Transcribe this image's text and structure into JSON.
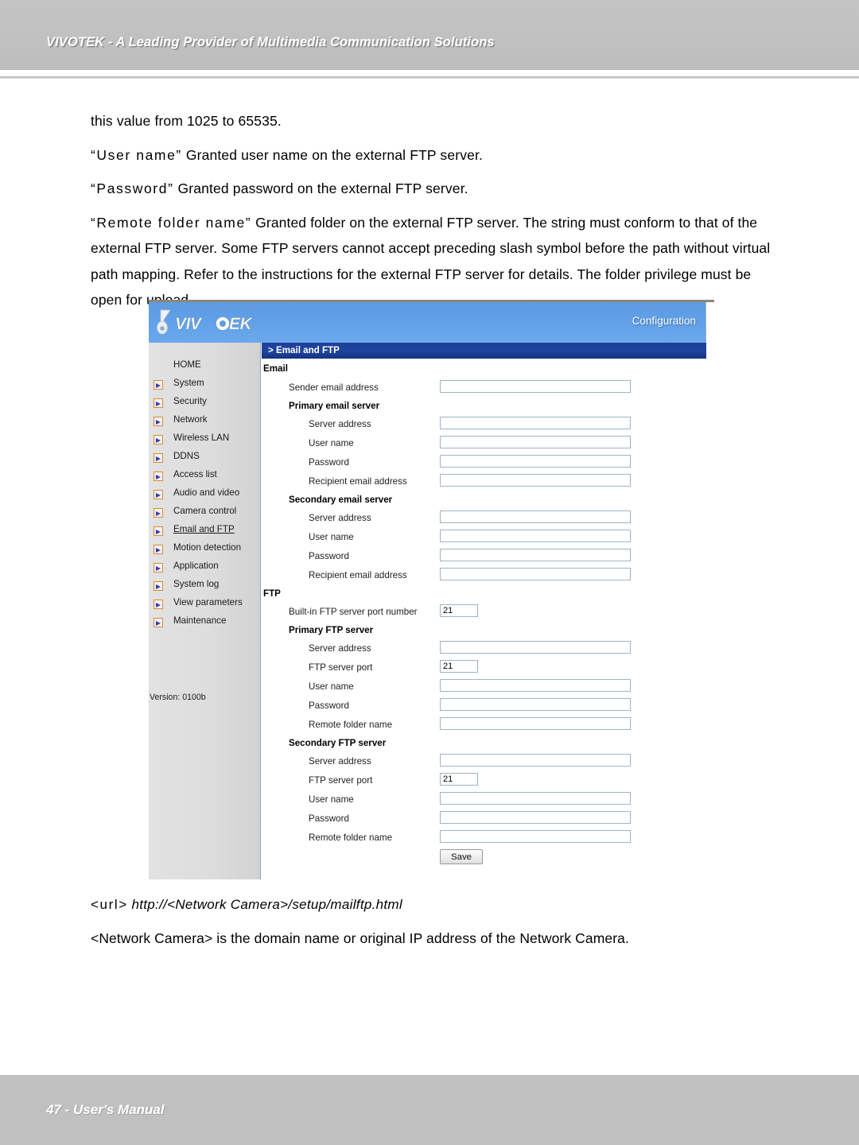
{
  "page": {
    "header_title": "VIVOTEK - A Leading Provider of Multimedia Communication Solutions",
    "footer_text": "47 - User's Manual"
  },
  "prose": {
    "line1": "this value from 1025 to 65535.",
    "line2_term": "“User name”",
    "line2_rest": " Granted user name on the external FTP server.",
    "line3_term": "“Password”",
    "line3_rest": " Granted password on the external FTP server.",
    "line4_term": "“Remote folder name”",
    "line4_rest": " Granted folder on the external FTP server. The string must conform to that of the external FTP server. Some FTP servers cannot accept preceding slash symbol before the path without virtual path mapping. Refer to the instructions for the external FTP server for details. The folder privilege must be open for upload.",
    "url_tag": "<url>",
    "url_value": "http://<Network Camera>/setup/mailftp.html",
    "url_note": "<Network Camera> is the domain name or original IP address of the Network Camera."
  },
  "screenshot": {
    "brand": "VIVOTEK",
    "config_label": "Configuration",
    "breadcrumb": "> Email and FTP",
    "version": "Version: 0100b",
    "sidebar": {
      "home": "HOME",
      "items": [
        {
          "label": "System",
          "active": false
        },
        {
          "label": "Security",
          "active": false
        },
        {
          "label": "Network",
          "active": false
        },
        {
          "label": "Wireless LAN",
          "active": false
        },
        {
          "label": "DDNS",
          "active": false
        },
        {
          "label": "Access list",
          "active": false
        },
        {
          "label": "Audio and video",
          "active": false
        },
        {
          "label": "Camera control",
          "active": false
        },
        {
          "label": "Email and FTP",
          "active": true
        },
        {
          "label": "Motion detection",
          "active": false
        },
        {
          "label": "Application",
          "active": false
        },
        {
          "label": "System log",
          "active": false
        },
        {
          "label": "View parameters",
          "active": false
        },
        {
          "label": "Maintenance",
          "active": false
        }
      ]
    },
    "form": {
      "email_section": "Email",
      "sender_label": "Sender email address",
      "sender_value": "",
      "primary_email_server": "Primary email server",
      "pri_server_address_label": "Server address",
      "pri_server_address_value": "",
      "pri_user_name_label": "User name",
      "pri_user_name_value": "",
      "pri_password_label": "Password",
      "pri_password_value": "",
      "pri_recipient_label": "Recipient email address",
      "pri_recipient_value": "",
      "secondary_email_server": "Secondary email server",
      "sec_server_address_label": "Server address",
      "sec_server_address_value": "",
      "sec_user_name_label": "User name",
      "sec_user_name_value": "",
      "sec_password_label": "Password",
      "sec_password_value": "",
      "sec_recipient_label": "Recipient email address",
      "sec_recipient_value": "",
      "ftp_section": "FTP",
      "builtin_port_label": "Built-in FTP server port number",
      "builtin_port_value": "21",
      "primary_ftp_server": "Primary FTP server",
      "pftp_server_address_label": "Server address",
      "pftp_server_address_value": "",
      "pftp_port_label": "FTP server port",
      "pftp_port_value": "21",
      "pftp_user_name_label": "User name",
      "pftp_user_name_value": "",
      "pftp_password_label": "Password",
      "pftp_password_value": "",
      "pftp_remote_folder_label": "Remote folder name",
      "pftp_remote_folder_value": "",
      "secondary_ftp_server": "Secondary FTP server",
      "sftp_server_address_label": "Server address",
      "sftp_server_address_value": "",
      "sftp_port_label": "FTP server port",
      "sftp_port_value": "21",
      "sftp_user_name_label": "User name",
      "sftp_user_name_value": "",
      "sftp_password_label": "Password",
      "sftp_password_value": "",
      "sftp_remote_folder_label": "Remote folder name",
      "sftp_remote_folder_value": "",
      "save_label": "Save"
    }
  }
}
